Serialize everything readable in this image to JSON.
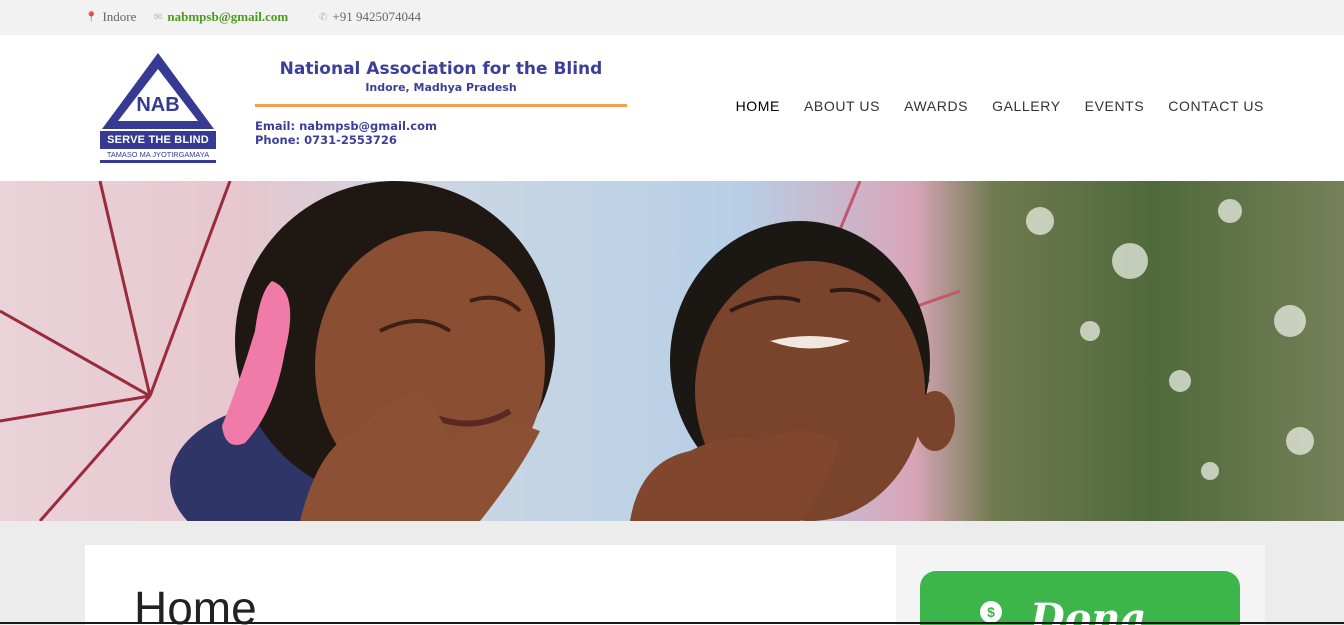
{
  "topbar": {
    "location": "Indore",
    "email": "nabmpsb@gmail.com",
    "phone": "+91 9425074044"
  },
  "logo": {
    "emblem_text": "NAB",
    "serve_text": "SERVE THE BLIND",
    "motto": "TAMASO MA JYOTIRGAMAYA",
    "title": "National Association for the Blind",
    "subtitle": "Indore, Madhya Pradesh",
    "email_line": "Email: nabmpsb@gmail.com",
    "phone_line": "Phone: 0731-2553726"
  },
  "nav": {
    "items": [
      "HOME",
      "ABOUT US",
      "AWARDS",
      "GALLERY",
      "EVENTS",
      "CONTACT US"
    ],
    "active": "HOME"
  },
  "main": {
    "page_title": "Home"
  },
  "sidebar": {
    "donate_label": "Dona"
  },
  "colors": {
    "brand_blue": "#363a92",
    "accent_green": "#3cb54a",
    "email_green": "#4f9a1f",
    "rule_orange": "#f0a050"
  }
}
